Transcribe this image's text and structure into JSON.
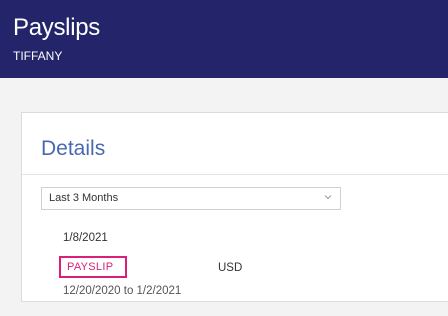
{
  "header": {
    "title": "Payslips",
    "subtitle": "TIFFANY"
  },
  "details": {
    "heading": "Details",
    "period_filter": {
      "selected": "Last 3 Months",
      "icon": "chevron-down-icon"
    },
    "payslips": [
      {
        "date": "1/8/2021",
        "link_label": "PAYSLIP",
        "currency": "USD",
        "period": "12/20/2020 to 1/2/2021"
      }
    ]
  },
  "colors": {
    "header_bg": "#23246a",
    "heading": "#4a68b1",
    "link": "#d8207a"
  }
}
